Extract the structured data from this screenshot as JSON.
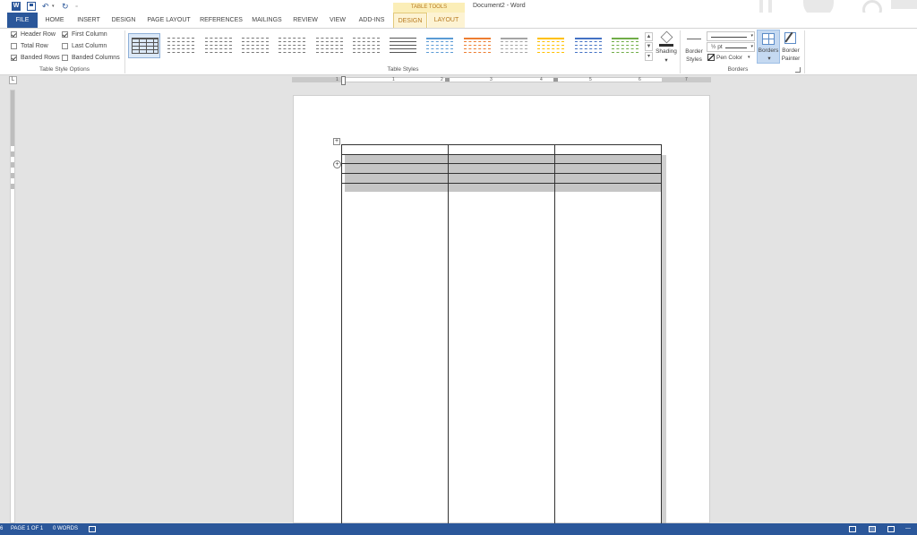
{
  "titlebar": {
    "title": "Document2 - Word",
    "contextual_group": "TABLE TOOLS",
    "qat": [
      "word-app-icon",
      "save-icon",
      "undo-icon",
      "redo-icon",
      "customize-qat-icon"
    ]
  },
  "tabs": [
    {
      "label": "FILE"
    },
    {
      "label": "HOME"
    },
    {
      "label": "INSERT"
    },
    {
      "label": "DESIGN"
    },
    {
      "label": "PAGE LAYOUT"
    },
    {
      "label": "REFERENCES"
    },
    {
      "label": "MAILINGS"
    },
    {
      "label": "REVIEW"
    },
    {
      "label": "VIEW"
    },
    {
      "label": "ADD-INS"
    },
    {
      "label": "DESIGN"
    },
    {
      "label": "LAYOUT"
    }
  ],
  "table_style_options": {
    "group_label": "Table Style Options",
    "options": [
      {
        "label": "Header Row",
        "checked": true
      },
      {
        "label": "First Column",
        "checked": true
      },
      {
        "label": "Total Row",
        "checked": false
      },
      {
        "label": "Last Column",
        "checked": false
      },
      {
        "label": "Banded Rows",
        "checked": true
      },
      {
        "label": "Banded Columns",
        "checked": false
      }
    ]
  },
  "table_styles": {
    "group_label": "Table Styles",
    "accent_colors": [
      "#555555",
      "#777777",
      "#777777",
      "#777777",
      "#777777",
      "#777777",
      "#777777",
      "#555555",
      "#5b9bd5",
      "#ed7d31",
      "#a5a5a5",
      "#ffc000",
      "#4472c4",
      "#70ad47"
    ]
  },
  "shading": {
    "label": "Shading"
  },
  "borders_group": {
    "group_label": "Borders",
    "border_styles_label_1": "Border",
    "border_styles_label_2": "Styles",
    "weight_value": "½ pt",
    "pen_color_label": "Pen Color",
    "borders_label": "Borders",
    "border_painter_label_1": "Border",
    "border_painter_label_2": "Painter"
  },
  "ruler": {
    "numbers": [
      "1",
      "1",
      "2",
      "3",
      "4",
      "5",
      "6",
      "7"
    ]
  },
  "statusbar": {
    "page": "PAGE 1 OF 1",
    "words": "0 WORDS",
    "zoom_marker": "—"
  }
}
